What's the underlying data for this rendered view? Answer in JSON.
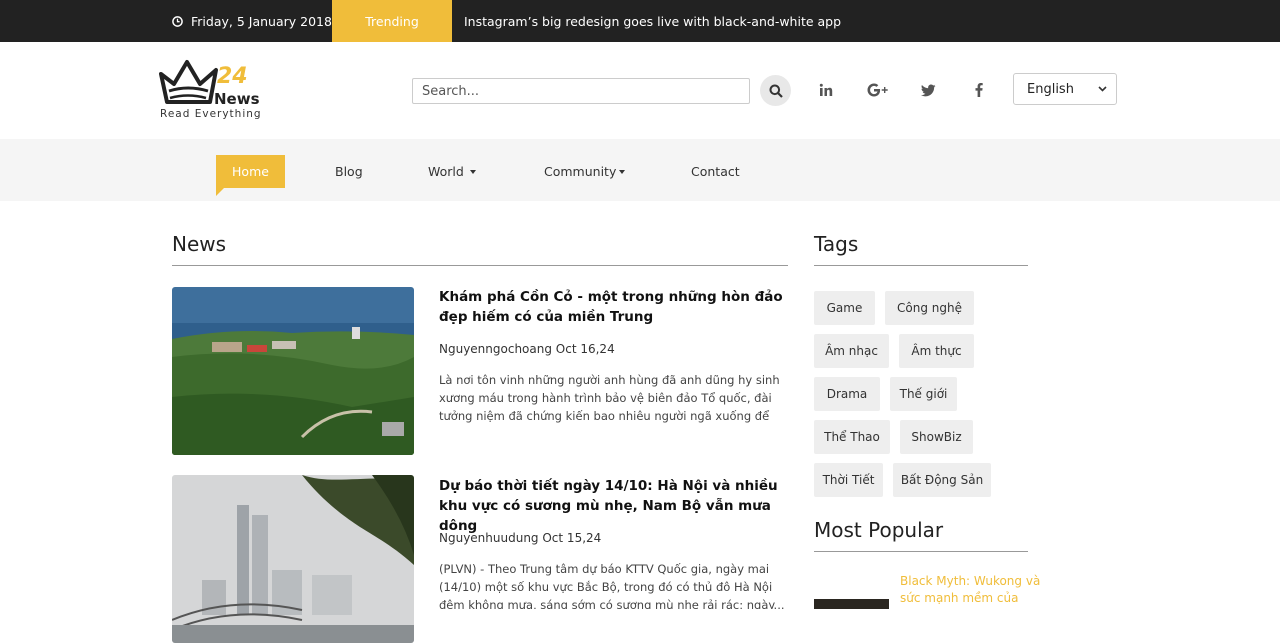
{
  "topbar": {
    "date": "Friday, 5 January 2018",
    "trending_label": "Trending",
    "trending_headline": "Instagram’s big redesign goes live with black-and-white app"
  },
  "logo": {
    "number": "24",
    "word": "News",
    "tagline": "Read Everything"
  },
  "search": {
    "placeholder": "Search...",
    "icon": "search-icon"
  },
  "social": [
    "linkedin-icon",
    "google-plus-icon",
    "twitter-icon",
    "facebook-icon"
  ],
  "language": {
    "selected": "English"
  },
  "nav": {
    "home": "Home",
    "blog": "Blog",
    "world": "World",
    "community": "Community",
    "contact": "Contact"
  },
  "news": {
    "heading": "News",
    "articles": [
      {
        "title": "Khám phá Cồn Cỏ - một trong những hòn đảo đẹp hiếm có của miền Trung",
        "meta": "Nguyenngochoang Oct 16,24",
        "excerpt": "Là nơi tôn vinh những người anh hùng đã anh dũng hy sinh xương máu trong hành trình bảo vệ biên đảo Tổ quốc, đài tưởng niệm đã chứng kiến bao nhiêu người ngã xuống để c..."
      },
      {
        "title": "Dự báo thời tiết ngày 14/10: Hà Nội và nhiều khu vực có sương mù nhẹ, Nam Bộ vẫn mưa dông",
        "meta": "Nguyenhuudung Oct 15,24",
        "excerpt": "(PLVN) - Theo Trung tâm dự báo KTTV Quốc gia, ngày mai (14/10) một số khu vực Bắc Bộ, trong đó có thủ đô Hà Nội đêm không mưa, sáng sớm có sương mù nhẹ rải rác; ngày..."
      }
    ]
  },
  "tags": {
    "heading": "Tags",
    "items": [
      "Game",
      "Công nghệ",
      "Âm nhạc",
      "Âm thực",
      "Drama",
      "Thế giới",
      "Thể Thao",
      "ShowBiz",
      "Thời Tiết",
      "Bất Động Sản"
    ]
  },
  "popular": {
    "heading": "Most Popular",
    "items": [
      {
        "title": "Black Myth: Wukong và sức mạnh mềm của"
      }
    ]
  },
  "colors": {
    "accent": "#f0bd3a",
    "topbar": "#222222",
    "nav_bg": "#f5f5f5"
  }
}
